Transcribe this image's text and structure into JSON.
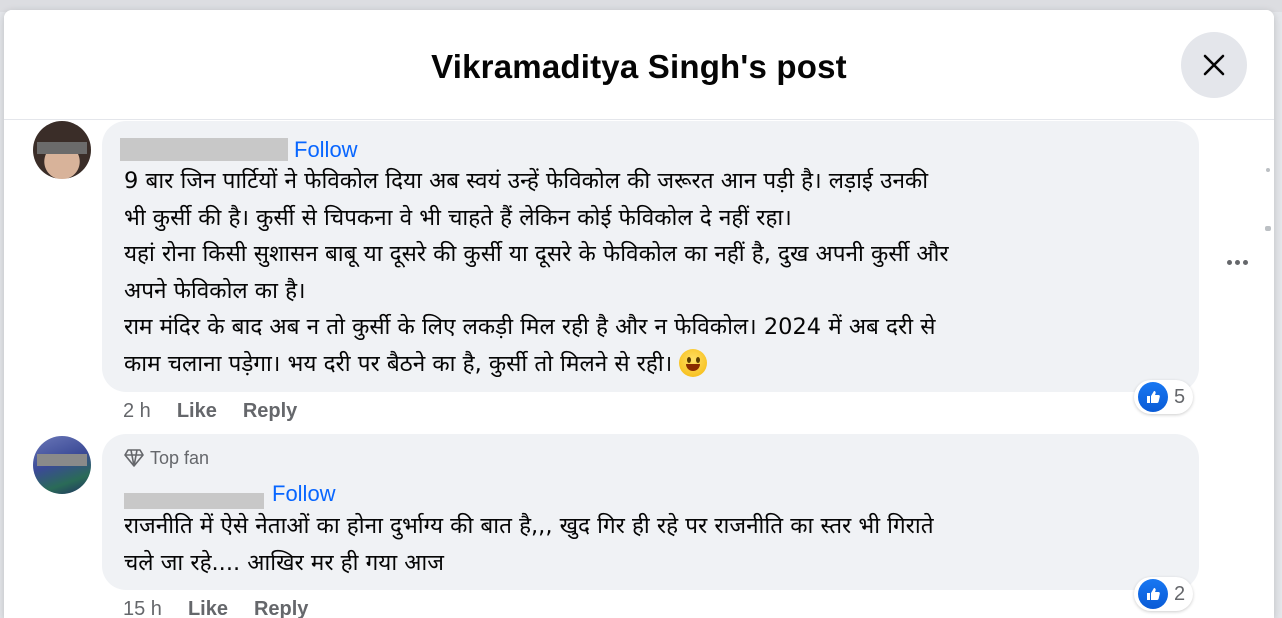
{
  "dialog": {
    "title": "Vikramaditya Singh's post",
    "close_label": "Close"
  },
  "comments": [
    {
      "follow_label": "Follow",
      "text_lines": [
        "9 बार जिन पार्टियों ने फेविकोल दिया अब स्वयं उन्हें फेविकोल की जरूरत आन पड़ी है। लड़ाई उनकी",
        "भी कुर्सी की है। कुर्सी से चिपकना वे भी चाहते हैं लेकिन कोई फेविकोल दे नहीं रहा।",
        "यहां रोना किसी सुशासन बाबू या दूसरे की कुर्सी या दूसरे के फेविकोल का नहीं है, दुख अपनी कुर्सी और",
        "अपने फेविकोल का है।",
        "राम मंदिर के बाद अब न तो कुर्सी के लिए लकड़ी मिल रही है और न फेविकोल। 2024 में अब दरी से",
        "काम चलाना पड़ेगा। भय दरी पर बैठने का है, कुर्सी तो मिलने से रही।"
      ],
      "time": "2 h",
      "like_label": "Like",
      "reply_label": "Reply",
      "reaction_count": "5"
    },
    {
      "badge": "Top fan",
      "follow_label": "Follow",
      "text_lines": [
        "राजनीति में ऐसे नेताओं का होना दुर्भाग्य की बात है,,, खुद गिर ही रहे पर राजनीति का स्तर भी गिराते",
        "चले जा रहे.... आखिर मर ही गया आज"
      ],
      "time": "15 h",
      "like_label": "Like",
      "reply_label": "Reply",
      "reaction_count": "2"
    }
  ],
  "colors": {
    "accent": "#0866ff",
    "bubble": "#f0f2f5",
    "meta_text": "#65676b"
  }
}
